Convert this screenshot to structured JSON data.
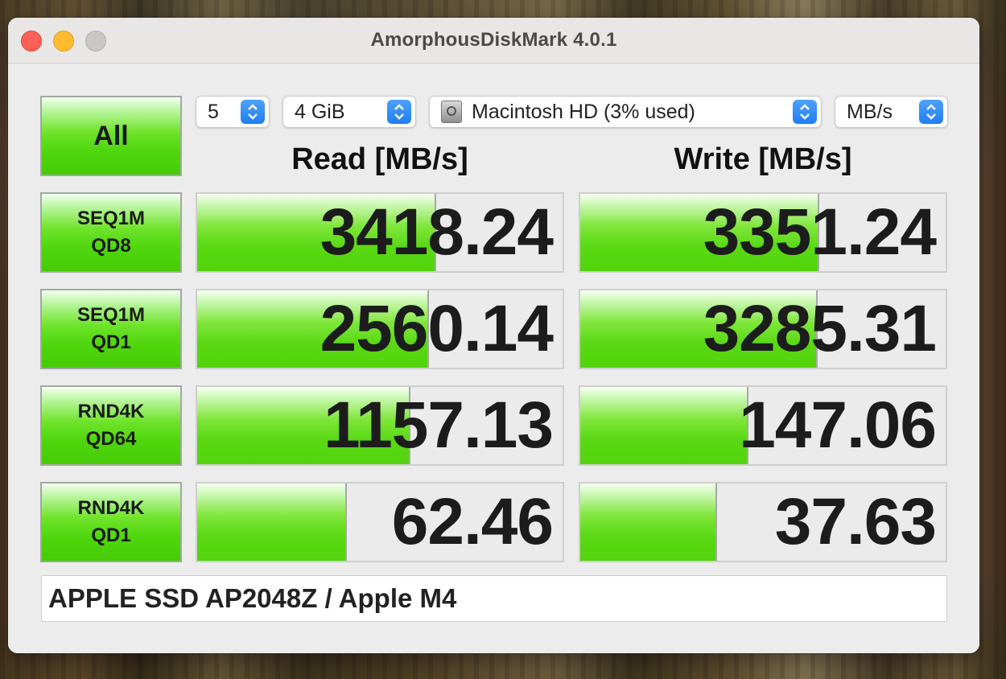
{
  "window": {
    "title": "AmorphousDiskMark 4.0.1"
  },
  "controls": {
    "all_button": "All",
    "count_select": "5",
    "size_select": "4 GiB",
    "drive_select": "Macintosh HD (3% used)",
    "unit_select": "MB/s"
  },
  "headers": {
    "read": "Read [MB/s]",
    "write": "Write [MB/s]"
  },
  "tests": [
    {
      "line1": "SEQ1M",
      "line2": "QD8",
      "read": "3418.24",
      "write": "3351.24",
      "read_fill": 0.65,
      "write_fill": 0.65
    },
    {
      "line1": "SEQ1M",
      "line2": "QD1",
      "read": "2560.14",
      "write": "3285.31",
      "read_fill": 0.63,
      "write_fill": 0.645
    },
    {
      "line1": "RND4K",
      "line2": "QD64",
      "read": "1157.13",
      "write": "147.06",
      "read_fill": 0.58,
      "write_fill": 0.455
    },
    {
      "line1": "RND4K",
      "line2": "QD1",
      "read": "62.46",
      "write": "37.63",
      "read_fill": 0.405,
      "write_fill": 0.37
    }
  ],
  "status": "APPLE SSD AP2048Z / Apple M4",
  "colors": {
    "green": "#53d40b",
    "close": "#fe5f57",
    "minimize": "#febc2e",
    "accent": "#1f7ef4"
  }
}
